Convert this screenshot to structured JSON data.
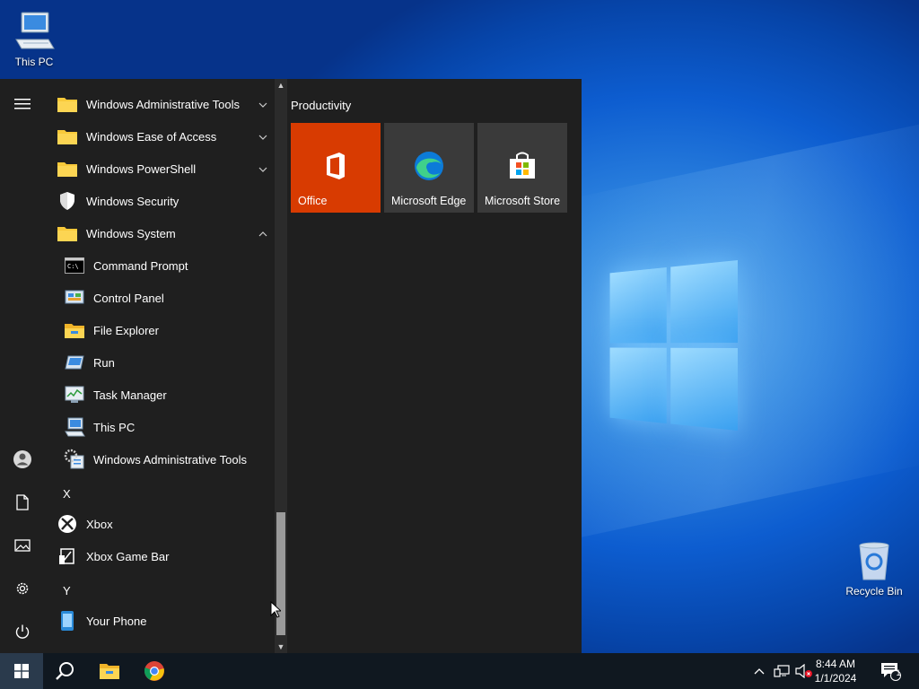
{
  "desktop": {
    "icons": [
      {
        "label": "This PC"
      },
      {
        "label": "Recycle Bin"
      }
    ]
  },
  "start_menu": {
    "apps": [
      {
        "label": "Windows Administrative Tools",
        "icon": "folder-icon",
        "chevron": "down"
      },
      {
        "label": "Windows Ease of Access",
        "icon": "folder-icon",
        "chevron": "down"
      },
      {
        "label": "Windows PowerShell",
        "icon": "folder-icon",
        "chevron": "down"
      },
      {
        "label": "Windows Security",
        "icon": "shield-icon"
      },
      {
        "label": "Windows System",
        "icon": "folder-icon",
        "chevron": "up"
      },
      {
        "label": "Command Prompt",
        "icon": "cmd-icon"
      },
      {
        "label": "Control Panel",
        "icon": "control-panel-icon"
      },
      {
        "label": "File Explorer",
        "icon": "file-explorer-icon"
      },
      {
        "label": "Run",
        "icon": "run-icon"
      },
      {
        "label": "Task Manager",
        "icon": "task-manager-icon"
      },
      {
        "label": "This PC",
        "icon": "computer-icon"
      },
      {
        "label": "Windows Administrative Tools",
        "icon": "admin-tools-icon"
      },
      {
        "label": "Xbox",
        "icon": "xbox-icon"
      },
      {
        "label": "Xbox Game Bar",
        "icon": "xbox-game-bar-icon"
      },
      {
        "label": "Your Phone",
        "icon": "phone-icon"
      }
    ],
    "letters": [
      "X",
      "Y"
    ],
    "group_title": "Productivity",
    "tiles": [
      {
        "label": "Office",
        "color": "#d83b01"
      },
      {
        "label": "Microsoft Edge",
        "color": "#3a3a3a"
      },
      {
        "label": "Microsoft Store",
        "color": "#3a3a3a"
      }
    ]
  },
  "taskbar": {
    "time": "8:44 AM",
    "date": "1/1/2024",
    "notification_count": "1"
  },
  "colors": {
    "accent": "#d83b01",
    "menu_bg": "#1f1f1f",
    "taskbar_bg": "#101820"
  }
}
